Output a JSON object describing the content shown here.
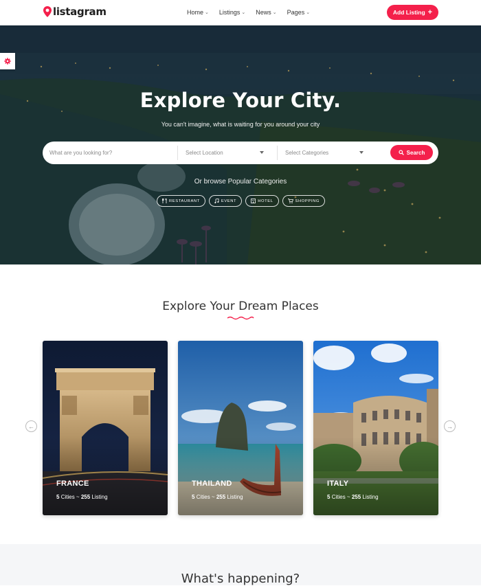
{
  "header": {
    "logo_text": "listagram",
    "nav": [
      {
        "label": "Home"
      },
      {
        "label": "Listings"
      },
      {
        "label": "News"
      },
      {
        "label": "Pages"
      }
    ],
    "add_listing_label": "Add Listing",
    "brand_color": "#f4204b"
  },
  "hero": {
    "title": "Explore Your City.",
    "subtitle": "You can't imagine, what is waiting for you around your city",
    "search": {
      "placeholder": "What are you looking for?",
      "location_placeholder": "Select Location",
      "category_placeholder": "Select Categories",
      "button_label": "Search"
    },
    "browse_label": "Or browse Popular Categories",
    "categories": [
      {
        "label": "RESTAURANT",
        "icon": "restaurant-icon"
      },
      {
        "label": "EVENT",
        "icon": "music-icon"
      },
      {
        "label": "HOTEL",
        "icon": "hotel-icon"
      },
      {
        "label": "SHOPPING",
        "icon": "cart-icon"
      }
    ]
  },
  "places": {
    "title": "Explore Your Dream Places",
    "cards": [
      {
        "name": "FRANCE",
        "cities": "5",
        "cities_label": "Cities ~",
        "listings": "255",
        "listings_label": "Listing"
      },
      {
        "name": "THAILAND",
        "cities": "5",
        "cities_label": "Cities ~",
        "listings": "255",
        "listings_label": "Listing"
      },
      {
        "name": "ITALY",
        "cities": "5",
        "cities_label": "Cities ~",
        "listings": "255",
        "listings_label": "Listing"
      }
    ]
  },
  "happening": {
    "title": "What's happening?"
  }
}
